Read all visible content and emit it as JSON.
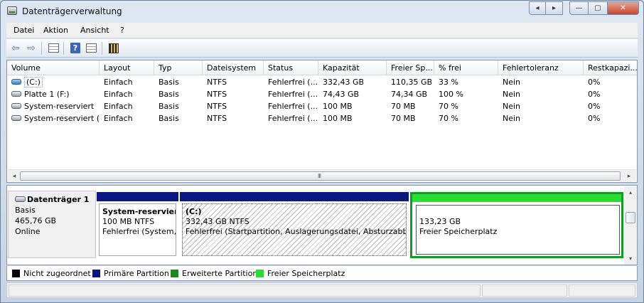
{
  "window": {
    "title": "Datenträgerverwaltung"
  },
  "titlebar_buttons": {
    "back": "◂",
    "fwd": "▸",
    "minimize": "—",
    "maximize": "▢",
    "close": "✕"
  },
  "menu": {
    "items": [
      "Datei",
      "Aktion",
      "Ansicht",
      "?"
    ]
  },
  "toolbar": {
    "icons": [
      "back-arrow-icon",
      "forward-arrow-icon",
      "console-tree-icon",
      "help-icon",
      "properties-icon",
      "disk-settings-icon"
    ]
  },
  "volumes": {
    "columns": [
      "Volume",
      "Layout",
      "Typ",
      "Dateisystem",
      "Status",
      "Kapazität",
      "Freier Sp...",
      "% frei",
      "Fehlertoleranz",
      "Restkapazi..."
    ],
    "rows": [
      {
        "volume": "(C:)",
        "layout": "Einfach",
        "typ": "Basis",
        "fs": "NTFS",
        "status": "Fehlerfrei (...",
        "cap": "332,43 GB",
        "free": "110,35 GB",
        "pct": "33 %",
        "ft": "Nein",
        "rest": "0%",
        "icon": "blue"
      },
      {
        "volume": "Platte 1 (F:)",
        "layout": "Einfach",
        "typ": "Basis",
        "fs": "NTFS",
        "status": "Fehlerfrei (...",
        "cap": "74,43 GB",
        "free": "74,34 GB",
        "pct": "100 %",
        "ft": "Nein",
        "rest": "0%",
        "icon": "gray"
      },
      {
        "volume": "System-reserviert",
        "layout": "Einfach",
        "typ": "Basis",
        "fs": "NTFS",
        "status": "Fehlerfrei (...",
        "cap": "100 MB",
        "free": "70 MB",
        "pct": "70 %",
        "ft": "Nein",
        "rest": "0%",
        "icon": "gray"
      },
      {
        "volume": "System-reserviert (...",
        "layout": "Einfach",
        "typ": "Basis",
        "fs": "NTFS",
        "status": "Fehlerfrei (...",
        "cap": "100 MB",
        "free": "70 MB",
        "pct": "70 %",
        "ft": "Nein",
        "rest": "0%",
        "icon": "gray"
      }
    ],
    "scroll_grip": "III"
  },
  "disk": {
    "name": "Datenträger 1",
    "type": "Basis",
    "size": "465,76 GB",
    "state": "Online",
    "partitions": [
      {
        "title": "System-reserviert",
        "line2": "100 MB NTFS",
        "line3": "Fehlerfrei (System, A"
      },
      {
        "title": "(C:)",
        "line2": "332,43 GB NTFS",
        "line3": "Fehlerfrei (Startpartition, Auslagerungsdatei, Absturzabbild"
      },
      {
        "line2": "133,23 GB",
        "line3": "Freier Speicherplatz"
      }
    ]
  },
  "legend": [
    {
      "label": "Nicht zugeordnet",
      "color": "#000000"
    },
    {
      "label": "Primäre Partition",
      "color": "#0b1881"
    },
    {
      "label": "Erweiterte Partition",
      "color": "#1a8a1a"
    },
    {
      "label": "Freier Speicherplatz",
      "color": "#27e02e"
    }
  ]
}
